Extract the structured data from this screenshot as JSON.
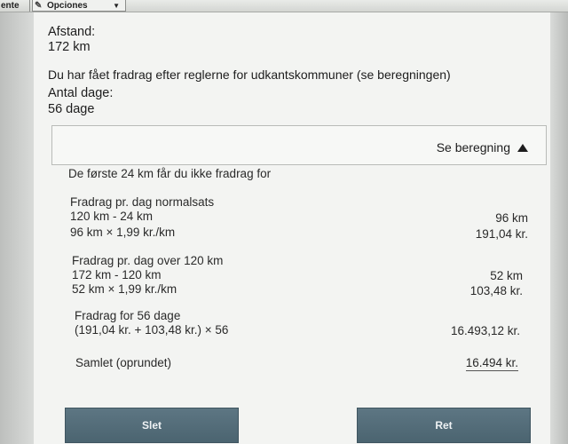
{
  "toolbar": {
    "left_label": "ente",
    "options_label": "Opciones"
  },
  "result": {
    "distance_label": "Afstand:",
    "distance_value": "172 km",
    "deduction_notice": "Du har fået fradrag efter reglerne for udkantskommuner (se beregningen)",
    "days_label": "Antal dage:",
    "days_value": "56 dage"
  },
  "calculation": {
    "toggle_label": "Se beregning",
    "intro": "De første 24 km får du ikke fradrag for",
    "normal": {
      "heading": "Fradrag pr. dag normalsats",
      "line1_text": "120 km - 24 km",
      "line1_value": "96 km",
      "line2_text": "96 km × 1,99 kr./km",
      "line2_value": "191,04 kr."
    },
    "over120": {
      "heading": "Fradrag pr. dag over 120 km",
      "line1_text": "172 km - 120 km",
      "line1_value": "52 km",
      "line2_text": "52 km × 1,99 kr./km",
      "line2_value": "103,48 kr."
    },
    "days": {
      "heading": "Fradrag for 56 dage",
      "line1_text": "(191,04 kr. + 103,48 kr.) × 56",
      "line1_value": "16.493,12 kr."
    },
    "total": {
      "label": "Samlet (oprundet)",
      "value": "16.494 kr."
    }
  },
  "buttons": {
    "delete_label": "Slet",
    "edit_label": "Ret"
  }
}
